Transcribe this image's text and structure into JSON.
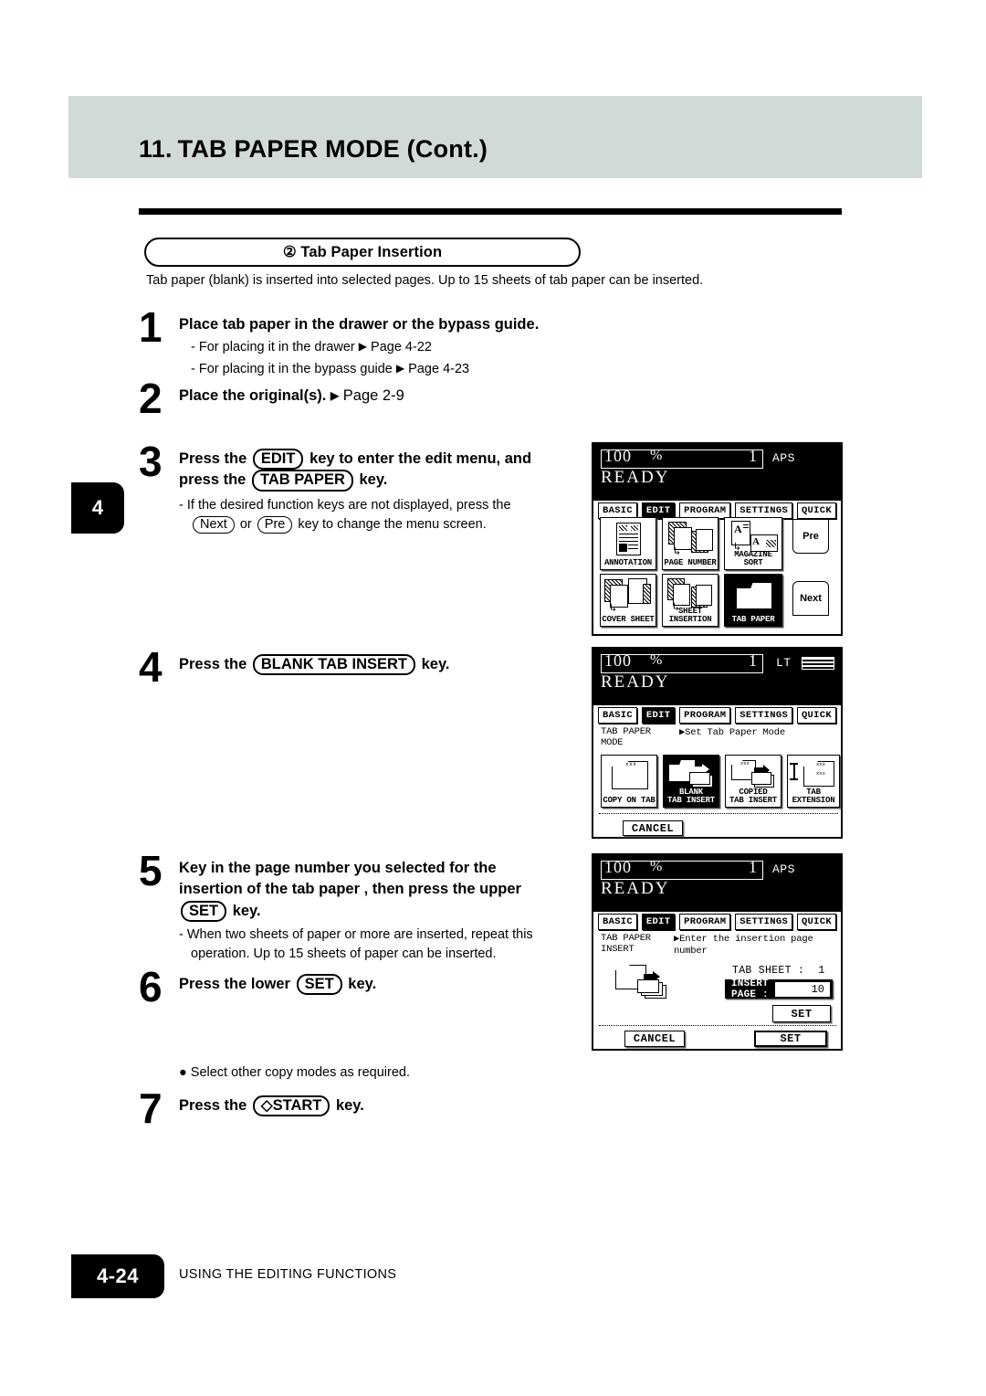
{
  "header": {
    "number": "11.",
    "title": "TAB PAPER MODE (Cont.)"
  },
  "section": {
    "pill_label": "② Tab Paper Insertion",
    "intro": "Tab paper (blank) is inserted into selected pages. Up to 15 sheets of tab paper can be inserted."
  },
  "chapter_tab": "4",
  "steps": [
    {
      "num": "1",
      "head_parts": [
        "Place tab paper in the drawer or the bypass guide."
      ],
      "subs": [
        {
          "dash": "-",
          "text": "For placing it in the drawer",
          "arrow": "▶",
          "page": "Page 4-22"
        },
        {
          "dash": "-",
          "text": "For placing it in the bypass guide",
          "arrow": "▶",
          "page": "Page 4-23"
        }
      ]
    },
    {
      "num": "2",
      "head_text": "Place the original(s).",
      "arrow": "▶",
      "page": "Page 2-9"
    },
    {
      "num": "3",
      "line1_a": "Press the",
      "key1": "EDIT",
      "line1_b": "key to enter the edit menu, and",
      "line2_a": "press the",
      "key2": "TAB PAPER",
      "line2_b": "key.",
      "sub_a": "- If the desired function keys are not displayed, press the",
      "sub_key1": "Next",
      "sub_mid": "or",
      "sub_key2": "Pre",
      "sub_b": "key to change the menu screen."
    },
    {
      "num": "4",
      "line_a": "Press the",
      "key": "BLANK TAB INSERT",
      "line_b": "key."
    },
    {
      "num": "5",
      "line1": "Key in the page number you selected for the",
      "line2": "insertion of the tab paper , then press the upper",
      "key": "SET",
      "line3_b": "key.",
      "sub": "- When two sheets of paper or more are inserted, repeat this operation. Up to 15 sheets of paper can be inserted."
    },
    {
      "num": "6",
      "line_a": "Press the lower",
      "key": "SET",
      "line_b": "key."
    },
    {
      "num": "7",
      "line_a": "Press the",
      "key": "◇START",
      "line_b": "key."
    }
  ],
  "bullet_note": "● Select other copy modes as required.",
  "lcd_panels": [
    {
      "id": "edit-menu",
      "zoom": "100",
      "percent": "%",
      "copies": "1",
      "paper_mode": "APS",
      "status": "READY",
      "tabs": [
        {
          "label": "BASIC",
          "selected": false
        },
        {
          "label": "EDIT",
          "selected": true
        },
        {
          "label": "PROGRAM",
          "selected": false
        },
        {
          "label": "SETTINGS",
          "selected": false
        },
        {
          "label": "QUICK",
          "selected": false
        }
      ],
      "function_keys": [
        {
          "label": "ANNOTATION",
          "icon": "annotation-icon",
          "selected": false
        },
        {
          "label": "PAGE NUMBER",
          "icon": "page-number-icon",
          "selected": false
        },
        {
          "label": "MAGAZINE SORT",
          "icon": "magazine-sort-icon",
          "selected": false
        },
        {
          "label": "COVER SHEET",
          "icon": "cover-sheet-icon",
          "selected": false
        },
        {
          "label": "SHEET INSERTION",
          "icon": "sheet-insertion-icon",
          "selected": false
        },
        {
          "label": "TAB PAPER",
          "icon": "tab-paper-icon",
          "selected": true
        }
      ],
      "nav": {
        "prev": "Pre",
        "next": "Next"
      }
    },
    {
      "id": "tab-paper-mode",
      "zoom": "100",
      "percent": "%",
      "copies": "1",
      "paper_mode": "LT",
      "status": "READY",
      "tabs": [
        {
          "label": "BASIC",
          "selected": false
        },
        {
          "label": "EDIT",
          "selected": true
        },
        {
          "label": "PROGRAM",
          "selected": false
        },
        {
          "label": "SETTINGS",
          "selected": false
        },
        {
          "label": "QUICK",
          "selected": false
        }
      ],
      "mode_label": "TAB PAPER\nMODE",
      "mode_message": "▶Set Tab Paper Mode",
      "function_keys": [
        {
          "label": "COPY ON TAB",
          "icon": "copy-on-tab-icon",
          "selected": false
        },
        {
          "label": "BLANK\nTAB INSERT",
          "icon": "blank-tab-insert-icon",
          "selected": true
        },
        {
          "label": "COPIED\nTAB INSERT",
          "icon": "copied-tab-insert-icon",
          "selected": false
        },
        {
          "label": "TAB\nEXTENSION",
          "icon": "tab-extension-icon",
          "selected": false
        }
      ],
      "cancel_label": "CANCEL"
    },
    {
      "id": "tab-paper-insert",
      "zoom": "100",
      "percent": "%",
      "copies": "1",
      "paper_mode": "APS",
      "status": "READY",
      "tabs": [
        {
          "label": "BASIC",
          "selected": false
        },
        {
          "label": "EDIT",
          "selected": true
        },
        {
          "label": "PROGRAM",
          "selected": false
        },
        {
          "label": "SETTINGS",
          "selected": false
        },
        {
          "label": "QUICK",
          "selected": false
        }
      ],
      "mode_label": "TAB PAPER\nINSERT",
      "mode_message": "▶Enter the insertion page\n number",
      "tab_sheet_label": "TAB SHEET :",
      "tab_sheet_value": "1",
      "insert_page_label": "INSERT PAGE :",
      "insert_page_value": "10",
      "upper_set_label": "SET",
      "cancel_label": "CANCEL",
      "lower_set_label": "SET"
    }
  ],
  "footer": {
    "page": "4-24",
    "section": "USING THE EDITING FUNCTIONS"
  }
}
